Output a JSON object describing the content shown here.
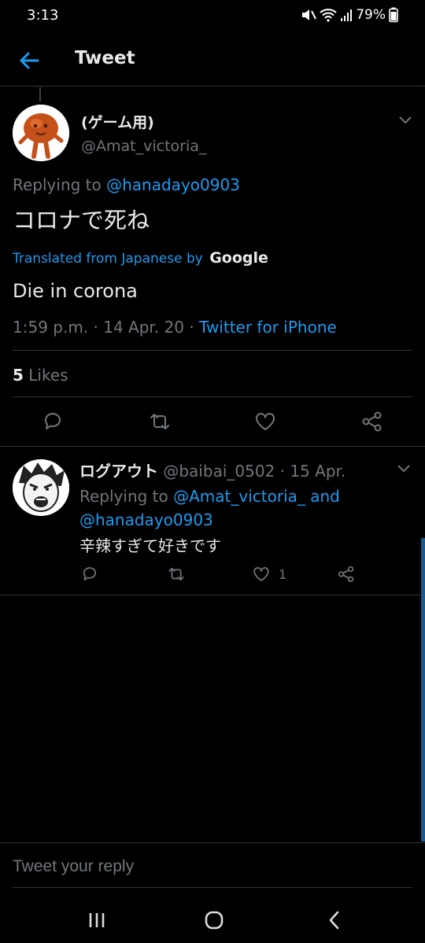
{
  "status_bar": {
    "time": "3:13",
    "battery": "79%"
  },
  "app_bar": {
    "title": "Tweet"
  },
  "main_tweet": {
    "display_name": "(ゲーム用)",
    "handle": "@Amat_victoria_",
    "replying_prefix": "Replying to",
    "replying_to": "@hanadayo0903",
    "text": "コロナで死ね",
    "translated_label": "Translated from Japanese by",
    "translator": "Google",
    "translation": "Die in corona",
    "timestamp": "1:59 p.m. · 14 Apr. 20 · ",
    "source": "Twitter for iPhone",
    "likes_count": "5",
    "likes_label": "Likes"
  },
  "reply_tweet": {
    "display_name": "ログアウト",
    "handle_date": "@baibai_0502 · 15 Apr.",
    "replying_prefix": "Replying to",
    "replying_to_1": "@Amat_victoria_ and",
    "replying_to_2": "@hanadayo0903",
    "text": "辛辣すぎて好きです",
    "like_count": "1"
  },
  "reply_composer": {
    "placeholder": "Tweet your reply"
  },
  "colors": {
    "background": "#000000",
    "accent": "#1d9bf0",
    "secondary_text": "#71767b",
    "divider": "#2f3336"
  },
  "icons": {
    "back": "arrow-left-icon",
    "caret": "chevron-down-icon",
    "reply": "comment-icon",
    "retweet": "retweet-icon",
    "like": "heart-icon",
    "share": "share-icon"
  }
}
